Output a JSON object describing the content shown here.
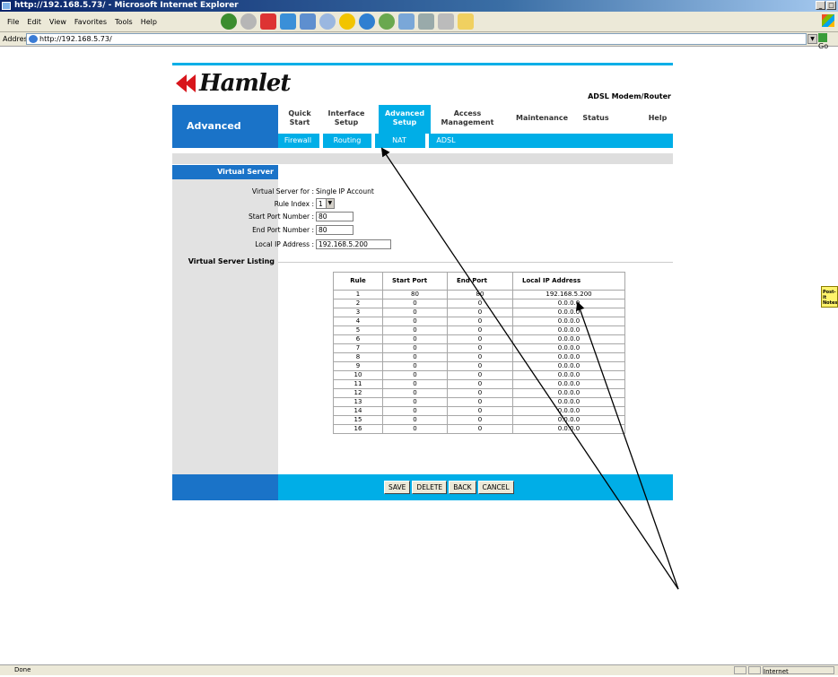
{
  "window": {
    "title": "http://192.168.5.73/ - Microsoft Internet Explorer"
  },
  "menu": [
    "File",
    "Edit",
    "View",
    "Favorites",
    "Tools",
    "Help"
  ],
  "address": {
    "label": "Address",
    "url": "http://192.168.5.73/",
    "go_label": "Go"
  },
  "status": {
    "text": "Done",
    "zone": "Internet"
  },
  "postit": "Post-it Notes",
  "router": {
    "brand": "Hamlet",
    "product": "ADSL Modem/Router",
    "section": "Advanced",
    "tabs": [
      {
        "line1": "Quick",
        "line2": "Start"
      },
      {
        "line1": "Interface",
        "line2": "Setup"
      },
      {
        "line1": "Advanced",
        "line2": "Setup"
      },
      {
        "line1": "Access",
        "line2": "Management"
      },
      {
        "line1": "Maintenance",
        "line2": ""
      },
      {
        "line1": "Status",
        "line2": ""
      },
      {
        "line1": "Help",
        "line2": ""
      }
    ],
    "subtabs": [
      "Firewall",
      "Routing",
      "NAT",
      "ADSL"
    ],
    "side_title": "Virtual Server",
    "side_listing": "Virtual Server Listing",
    "form": {
      "vs_for_label": "Virtual Server for :",
      "vs_for_value": "Single IP Account",
      "rule_index_label": "Rule Index :",
      "rule_index_value": "1",
      "start_port_label": "Start Port Number :",
      "start_port_value": "80",
      "end_port_label": "End Port Number :",
      "end_port_value": "80",
      "local_ip_label": "Local IP Address :",
      "local_ip_value": "192.168.5.200"
    },
    "table": {
      "headers": [
        "Rule",
        "Start Port",
        "End Port",
        "Local IP Address"
      ],
      "rows": [
        [
          "1",
          "80",
          "80",
          "192.168.5.200"
        ],
        [
          "2",
          "0",
          "0",
          "0.0.0.0"
        ],
        [
          "3",
          "0",
          "0",
          "0.0.0.0"
        ],
        [
          "4",
          "0",
          "0",
          "0.0.0.0"
        ],
        [
          "5",
          "0",
          "0",
          "0.0.0.0"
        ],
        [
          "6",
          "0",
          "0",
          "0.0.0.0"
        ],
        [
          "7",
          "0",
          "0",
          "0.0.0.0"
        ],
        [
          "8",
          "0",
          "0",
          "0.0.0.0"
        ],
        [
          "9",
          "0",
          "0",
          "0.0.0.0"
        ],
        [
          "10",
          "0",
          "0",
          "0.0.0.0"
        ],
        [
          "11",
          "0",
          "0",
          "0.0.0.0"
        ],
        [
          "12",
          "0",
          "0",
          "0.0.0.0"
        ],
        [
          "13",
          "0",
          "0",
          "0.0.0.0"
        ],
        [
          "14",
          "0",
          "0",
          "0.0.0.0"
        ],
        [
          "15",
          "0",
          "0",
          "0.0.0.0"
        ],
        [
          "16",
          "0",
          "0",
          "0.0.0.0"
        ]
      ]
    },
    "buttons": {
      "save": "SAVE",
      "delete": "DELETE",
      "back": "BACK",
      "cancel": "CANCEL"
    }
  },
  "colors": {
    "accent": "#00aee7",
    "section_blue": "#1a73c8",
    "brand_red": "#d8161c"
  }
}
